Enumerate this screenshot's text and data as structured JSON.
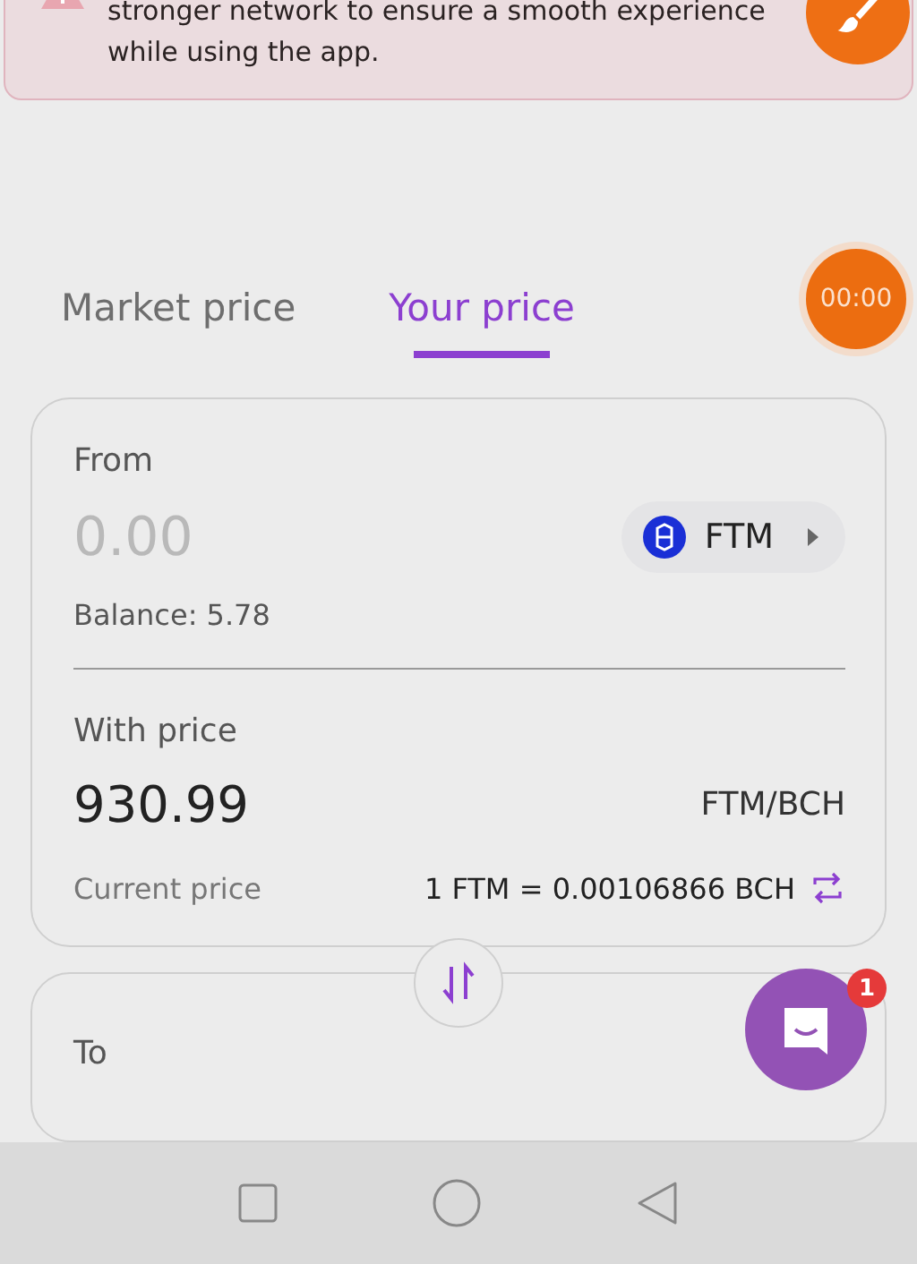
{
  "alert": {
    "message": "stronger network to ensure a smooth experience while using the app."
  },
  "timer": "00:00",
  "tabs": [
    {
      "label": "Market price",
      "selected": false
    },
    {
      "label": "Your price",
      "selected": true
    }
  ],
  "from": {
    "label": "From",
    "placeholder": "0.00",
    "token": "FTM",
    "balance": "Balance: 5.78"
  },
  "price": {
    "label": "With price",
    "value": "930.99",
    "pair": "FTM/BCH",
    "current_label": "Current price",
    "current_rate": "1 FTM = 0.00106866 BCH"
  },
  "to": {
    "label": "To"
  },
  "chat": {
    "badge": "1"
  }
}
